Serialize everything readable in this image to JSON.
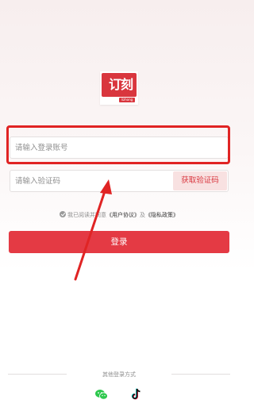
{
  "logo": {
    "mark_text": "订刻",
    "sub_text": "lizhong"
  },
  "login_form": {
    "account_placeholder": "请输入登录账号",
    "code_placeholder": "请输入验证码",
    "get_code_label": "获取验证码",
    "agreement": {
      "prefix": "我已阅读并同意",
      "user_agreement": "《用户协议》",
      "and": "及",
      "privacy_policy": "《隐私政策》"
    },
    "login_label": "登录"
  },
  "other_login": {
    "label": "其他登录方式",
    "methods": [
      {
        "icon": "wechat-icon",
        "color": "#2dc84d"
      },
      {
        "icon": "tiktok-icon",
        "color": "#111111"
      }
    ]
  },
  "colors": {
    "primary": "#e43a44",
    "highlight": "#e02424"
  }
}
